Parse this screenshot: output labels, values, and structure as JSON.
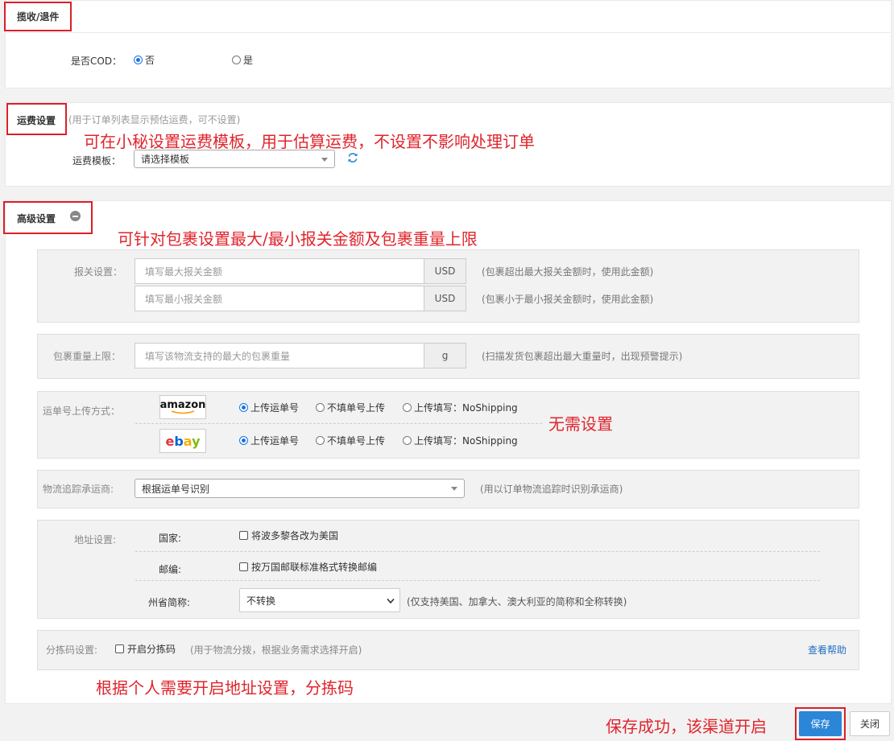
{
  "receive": {
    "title": "揽收/退件",
    "cod_label": "是否COD：",
    "cod_options": [
      "否",
      "是"
    ]
  },
  "shipping": {
    "title": "运费设置",
    "subtitle": "(用于订单列表显示预估运费，可不设置)",
    "annotation": "可在小秘设置运费模板，用于估算运费，不设置不影响处理订单",
    "template_label": "运费模板：",
    "template_value": "请选择模板"
  },
  "advanced": {
    "title": "高级设置",
    "annotation": "可针对包裹设置最大/最小报关金额及包裹重量上限",
    "declare": {
      "label": "报关设置：",
      "max_placeholder": "填写最大报关金额",
      "min_placeholder": "填写最小报关金额",
      "unit": "USD",
      "max_hint": "(包裹超出最大报关金额时，使用此金额)",
      "min_hint": "(包裹小于最小报关金额时，使用此金额)"
    },
    "weight": {
      "label": "包裹重量上限：",
      "placeholder": "填写该物流支持的最大的包裹重量",
      "unit": "g",
      "hint": "(扫描发货包裹超出最大重量时，出现预警提示)"
    },
    "tracking_upload": {
      "label": "运单号上传方式：",
      "annotation": "无需设置",
      "platforms": [
        {
          "name": "amazon",
          "opts": [
            "上传运单号",
            "不填单号上传",
            "上传填写：NoShipping"
          ]
        },
        {
          "name": "ebay",
          "opts": [
            "上传运单号",
            "不填单号上传",
            "上传填写：NoShipping"
          ]
        }
      ]
    },
    "carrier": {
      "label": "物流追踪承运商:",
      "value": "根据运单号识别",
      "hint": "(用以订单物流追踪时识别承运商)"
    },
    "address": {
      "label": "地址设置:",
      "country_label": "国家:",
      "country_option": "将波多黎各改为美国",
      "zip_label": "邮编:",
      "zip_option": "按万国邮联标准格式转换邮编",
      "state_label": "州省简称:",
      "state_value": "不转换",
      "state_hint": "(仅支持美国、加拿大、澳大利亚的简称和全称转换)"
    },
    "sort_code": {
      "label": "分拣码设置:",
      "option": "开启分拣码",
      "hint": "(用于物流分拨，根据业务需求选择开启)",
      "help": "查看帮助"
    },
    "bottom_annotation": "根据个人需要开启地址设置，分拣码"
  },
  "footer": {
    "annotation": "保存成功，该渠道开启",
    "save": "保存",
    "close": "关闭"
  },
  "colors": {
    "annotation_red": "#e0242c",
    "primary_blue": "#2b86d8"
  }
}
